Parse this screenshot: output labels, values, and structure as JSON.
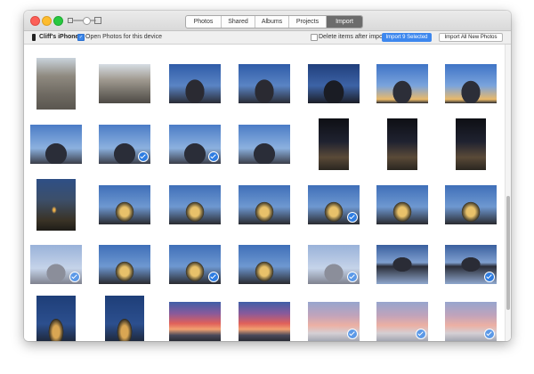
{
  "window": {
    "tabs": [
      {
        "label": "Photos",
        "active": false
      },
      {
        "label": "Shared",
        "active": false
      },
      {
        "label": "Albums",
        "active": false
      },
      {
        "label": "Projects",
        "active": false
      },
      {
        "label": "Import",
        "active": true
      }
    ]
  },
  "toolbar": {
    "device_name": "Cliff's iPhone",
    "open_photos_label": "Open Photos for this device",
    "open_photos_checked": true,
    "delete_items_label": "Delete items after import",
    "delete_items_checked": false,
    "import_selected_label": "Import 9 Selected",
    "import_all_label": "Import All New Photos"
  },
  "photos": {
    "rows": [
      [
        {
          "scene": "alley-stone",
          "selected": false
        },
        {
          "scene": "stone-arch",
          "selected": false
        },
        {
          "scene": "castle-dusk",
          "selected": false
        },
        {
          "scene": "castle-dusk",
          "selected": false
        },
        {
          "scene": "castle-dark",
          "selected": false
        },
        {
          "scene": "castle-bright",
          "selected": false
        },
        {
          "scene": "castle-bright",
          "selected": false
        }
      ],
      [
        {
          "scene": "castle-blue",
          "selected": false
        },
        {
          "scene": "castle-blue",
          "selected": true
        },
        {
          "scene": "castle-blue",
          "selected": true
        },
        {
          "scene": "castle-blue",
          "selected": false
        },
        {
          "scene": "street-night",
          "selected": false
        },
        {
          "scene": "street-night",
          "selected": false
        },
        {
          "scene": "street-night",
          "selected": false
        }
      ],
      [
        {
          "scene": "tower-night",
          "selected": false
        },
        {
          "scene": "castle-lit",
          "selected": false
        },
        {
          "scene": "castle-lit",
          "selected": false
        },
        {
          "scene": "castle-lit",
          "selected": false
        },
        {
          "scene": "castle-lit",
          "selected": true
        },
        {
          "scene": "castle-lit",
          "selected": false
        },
        {
          "scene": "castle-lit",
          "selected": false
        }
      ],
      [
        {
          "scene": "castle-pale",
          "selected": true
        },
        {
          "scene": "castle-lit",
          "selected": false
        },
        {
          "scene": "castle-lit",
          "selected": true
        },
        {
          "scene": "castle-lit",
          "selected": false
        },
        {
          "scene": "castle-pale",
          "selected": true
        },
        {
          "scene": "castle-water",
          "selected": false
        },
        {
          "scene": "castle-water",
          "selected": true
        }
      ],
      [
        {
          "scene": "castle-night",
          "selected": false
        },
        {
          "scene": "castle-night",
          "selected": false
        },
        {
          "scene": "sunset",
          "selected": false
        },
        {
          "scene": "sunset",
          "selected": false
        },
        {
          "scene": "sunset-pale",
          "selected": true
        },
        {
          "scene": "sunset-pale",
          "selected": true
        },
        {
          "scene": "sunset-pale",
          "selected": true
        }
      ]
    ]
  }
}
